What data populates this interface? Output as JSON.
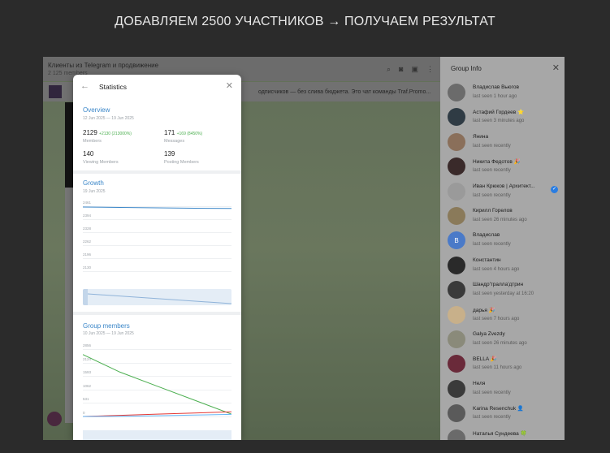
{
  "headline": "ДОБАВЛЯЕМ 2500 УЧАСТНИКОВ → ПОЛУЧАЕМ РЕЗУЛЬТАТ",
  "chat": {
    "title": "Клиенты из Telegram и продвижение",
    "subtitle": "2 125 members",
    "pinned_text": "одписчиков — без слива бюджета. Это чат команды Traf.Promo..."
  },
  "statistics": {
    "title": "Statistics",
    "overview": {
      "title": "Overview",
      "date": "12 Jun 2025 — 19 Jun 2025",
      "members_value": "2129",
      "members_delta": "+2130 (213000%)",
      "members_label": "Members",
      "messages_value": "171",
      "messages_delta": "+169 (8450%)",
      "messages_label": "Messages",
      "viewing_value": "140",
      "viewing_label": "Viewing Members",
      "posting_value": "139",
      "posting_label": "Posting Members"
    },
    "growth": {
      "title": "Growth",
      "date": "19 Jun 2025",
      "ticks": [
        "2461",
        "2394",
        "2328",
        "2262",
        "2196",
        "2130"
      ]
    },
    "group_members": {
      "title": "Group members",
      "date": "10 Jun 2025 — 19 Jun 2025",
      "ticks": [
        "2856",
        "2124",
        "1593",
        "1062",
        "531",
        "0"
      ]
    }
  },
  "group_info": {
    "title": "Group Info",
    "members": [
      {
        "name": "Владислав Вьюгов",
        "status": "last seen 1 hour ago",
        "color": "#6b6b6b",
        "initial": ""
      },
      {
        "name": "Астафий Гордеев ⭐",
        "status": "last seen 3 minutes ago",
        "color": "#2f3b44",
        "initial": ""
      },
      {
        "name": "Янина",
        "status": "last seen recently",
        "color": "#8a6f5a",
        "initial": ""
      },
      {
        "name": "Никита Федотов 🎉",
        "status": "last seen recently",
        "color": "#3a2a2a",
        "initial": ""
      },
      {
        "name": "Иван Крюков | Архитект...",
        "status": "last seen recently",
        "color": "#9a9a9a",
        "initial": ""
      },
      {
        "name": "Кирилл Горелов",
        "status": "last seen 26 minutes ago",
        "color": "#8a7a5a",
        "initial": ""
      },
      {
        "name": "Владислав",
        "status": "last seen recently",
        "color": "#4a7ac8",
        "initial": "В"
      },
      {
        "name": "Константин",
        "status": "last seen 4 hours ago",
        "color": "#2a2a2a",
        "initial": ""
      },
      {
        "name": "Шандр'тралла'дтрин",
        "status": "last seen yesterday at 16:20",
        "color": "#3a3a3a",
        "initial": ""
      },
      {
        "name": "дарья 🎉",
        "status": "last seen 7 hours ago",
        "color": "#c8b08a",
        "initial": ""
      },
      {
        "name": "Galya Zvezdy",
        "status": "last seen 26 minutes ago",
        "color": "#8a8a7a",
        "initial": ""
      },
      {
        "name": "BELLA 🎉",
        "status": "last seen 11 hours ago",
        "color": "#6a2a3a",
        "initial": ""
      },
      {
        "name": "Неля",
        "status": "last seen recently",
        "color": "#3a3a3a",
        "initial": ""
      },
      {
        "name": "Karina Resenchuk 👤",
        "status": "last seen recently",
        "color": "#5a5a5a",
        "initial": ""
      },
      {
        "name": "Наталья Сундеева 🍀",
        "status": "",
        "color": "#6a6a6a",
        "initial": ""
      }
    ]
  },
  "chart_data": [
    {
      "type": "line",
      "title": "Growth",
      "yticks": [
        2461,
        2394,
        2328,
        2262,
        2196,
        2130
      ],
      "ylim": [
        2130,
        2461
      ],
      "series": [
        {
          "values": [
            2461,
            2459,
            2457,
            2455,
            2454
          ]
        }
      ]
    },
    {
      "type": "line",
      "title": "Group members",
      "yticks": [
        2856,
        2124,
        1593,
        1062,
        531,
        0
      ],
      "ylim": [
        0,
        2856
      ],
      "series": [
        {
          "values": [
            2656,
            1900,
            1300,
            700,
            100
          ],
          "color": "#4caf50"
        },
        {
          "values": [
            0,
            50,
            100,
            150,
            200
          ],
          "color": "#e53935"
        },
        {
          "values": [
            0,
            10,
            30,
            60,
            90
          ],
          "color": "#64b5f6"
        }
      ]
    }
  ]
}
